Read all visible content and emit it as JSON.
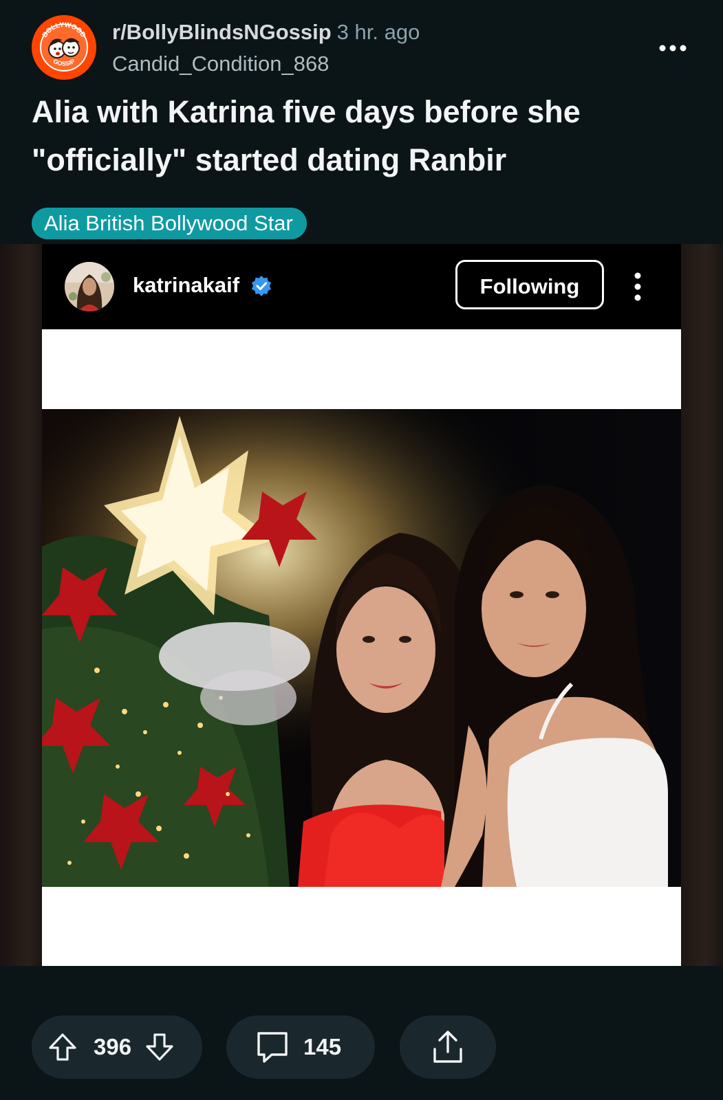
{
  "post": {
    "subreddit": "r/BollyBlindsNGossip",
    "time_ago": "3 hr. ago",
    "author": "Candid_Condition_868",
    "title": "Alia with Katrina five days before she \"officially\" started dating Ranbir",
    "flair": "Alia British Bollywood Star",
    "subreddit_logo": {
      "top_text": "BOLLYWOOD",
      "bottom_text": "GOSSIP"
    }
  },
  "embed": {
    "username": "katrinakaif",
    "follow_label": "Following",
    "verified_color": "#3897f0"
  },
  "actions": {
    "upvotes": "396",
    "comments": "145"
  },
  "colors": {
    "background": "#0b1416",
    "flair": "#0f9aa2",
    "subreddit_icon": "#ff4500",
    "pill": "#1a282d"
  },
  "icons": {
    "more": "horizontal-dots-icon",
    "upvote": "arrow-up-icon",
    "downvote": "arrow-down-icon",
    "comment": "speech-bubble-icon",
    "share": "share-upload-icon",
    "ig_more": "vertical-dots-icon",
    "verified": "verified-check-icon"
  }
}
